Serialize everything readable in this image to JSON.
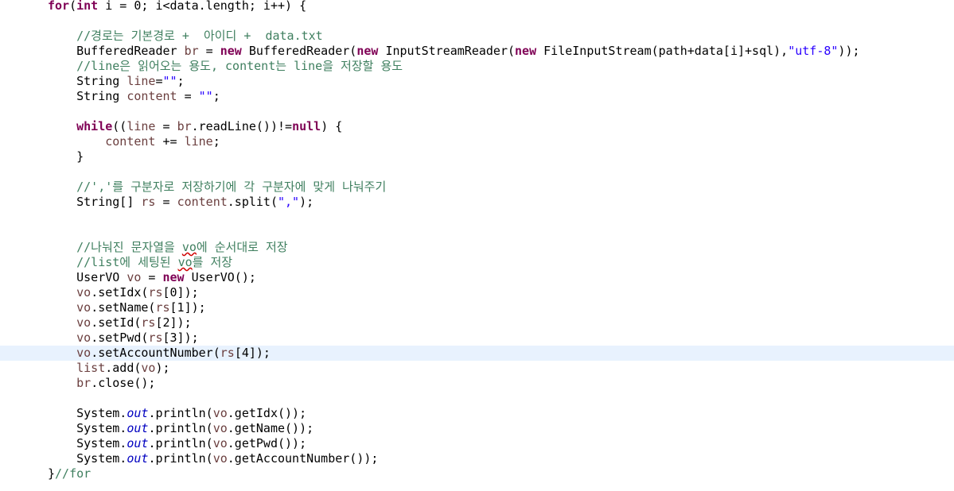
{
  "editor": {
    "current_line": 23,
    "colors": {
      "background": "#ffffff",
      "current_line": "#e8f2fe",
      "keyword": "#7f0055",
      "comment": "#3f7f5f",
      "string": "#2a00ff",
      "static_field": "#0000c0",
      "local_variable": "#6a3e3e",
      "plain": "#000000"
    },
    "lines": [
      [
        {
          "t": "for",
          "c": "kw"
        },
        {
          "t": "(",
          "c": ""
        },
        {
          "t": "int",
          "c": "kw"
        },
        {
          "t": " i = 0; i<data.length; i++) {",
          "c": ""
        }
      ],
      [],
      [
        {
          "t": "    //경로는 기본경로 +  아이디 +  data.txt",
          "c": "cm"
        }
      ],
      [
        {
          "t": "    BufferedReader ",
          "c": ""
        },
        {
          "t": "br",
          "c": "var"
        },
        {
          "t": " = ",
          "c": ""
        },
        {
          "t": "new",
          "c": "kw"
        },
        {
          "t": " BufferedReader(",
          "c": ""
        },
        {
          "t": "new",
          "c": "kw"
        },
        {
          "t": " InputStreamReader(",
          "c": ""
        },
        {
          "t": "new",
          "c": "kw"
        },
        {
          "t": " FileInputStream(path+data[i]+sql),",
          "c": ""
        },
        {
          "t": "\"utf-8\"",
          "c": "str"
        },
        {
          "t": "));",
          "c": ""
        }
      ],
      [
        {
          "t": "    //line은 읽어오는 용도, content는 line을 저장할 용도",
          "c": "cm"
        }
      ],
      [
        {
          "t": "    String ",
          "c": ""
        },
        {
          "t": "line",
          "c": "var"
        },
        {
          "t": "=",
          "c": ""
        },
        {
          "t": "\"\"",
          "c": "str"
        },
        {
          "t": ";",
          "c": ""
        }
      ],
      [
        {
          "t": "    String ",
          "c": ""
        },
        {
          "t": "content",
          "c": "var"
        },
        {
          "t": " = ",
          "c": ""
        },
        {
          "t": "\"\"",
          "c": "str"
        },
        {
          "t": ";",
          "c": ""
        }
      ],
      [],
      [
        {
          "t": "    ",
          "c": ""
        },
        {
          "t": "while",
          "c": "kw"
        },
        {
          "t": "((",
          "c": ""
        },
        {
          "t": "line",
          "c": "var"
        },
        {
          "t": " = ",
          "c": ""
        },
        {
          "t": "br",
          "c": "var"
        },
        {
          "t": ".readLine())!=",
          "c": ""
        },
        {
          "t": "null",
          "c": "kw"
        },
        {
          "t": ") {",
          "c": ""
        }
      ],
      [
        {
          "t": "        ",
          "c": ""
        },
        {
          "t": "content",
          "c": "var"
        },
        {
          "t": " += ",
          "c": ""
        },
        {
          "t": "line",
          "c": "var"
        },
        {
          "t": ";",
          "c": ""
        }
      ],
      [
        {
          "t": "    }",
          "c": ""
        }
      ],
      [],
      [
        {
          "t": "    //','를 구분자로 저장하기에 각 구분자에 맞게 나눠주기",
          "c": "cm"
        }
      ],
      [
        {
          "t": "    String[] ",
          "c": ""
        },
        {
          "t": "rs",
          "c": "var"
        },
        {
          "t": " = ",
          "c": ""
        },
        {
          "t": "content",
          "c": "var"
        },
        {
          "t": ".split(",
          "c": ""
        },
        {
          "t": "\",\"",
          "c": "str"
        },
        {
          "t": ");",
          "c": ""
        }
      ],
      [],
      [],
      [
        {
          "t": "    //나눠진 문자열을 ",
          "c": "cm"
        },
        {
          "t": "vo",
          "c": "cm spell"
        },
        {
          "t": "에 순서대로 저장",
          "c": "cm"
        }
      ],
      [
        {
          "t": "    //list에 세팅된 ",
          "c": "cm"
        },
        {
          "t": "vo",
          "c": "cm spell"
        },
        {
          "t": "를 저장",
          "c": "cm"
        }
      ],
      [
        {
          "t": "    UserVO ",
          "c": ""
        },
        {
          "t": "vo",
          "c": "var"
        },
        {
          "t": " = ",
          "c": ""
        },
        {
          "t": "new",
          "c": "kw"
        },
        {
          "t": " UserVO();",
          "c": ""
        }
      ],
      [
        {
          "t": "    ",
          "c": ""
        },
        {
          "t": "vo",
          "c": "var"
        },
        {
          "t": ".setIdx(",
          "c": ""
        },
        {
          "t": "rs",
          "c": "var"
        },
        {
          "t": "[0]);",
          "c": ""
        }
      ],
      [
        {
          "t": "    ",
          "c": ""
        },
        {
          "t": "vo",
          "c": "var"
        },
        {
          "t": ".setName(",
          "c": ""
        },
        {
          "t": "rs",
          "c": "var"
        },
        {
          "t": "[1]);",
          "c": ""
        }
      ],
      [
        {
          "t": "    ",
          "c": ""
        },
        {
          "t": "vo",
          "c": "var"
        },
        {
          "t": ".setId(",
          "c": ""
        },
        {
          "t": "rs",
          "c": "var"
        },
        {
          "t": "[2]);",
          "c": ""
        }
      ],
      [
        {
          "t": "    ",
          "c": ""
        },
        {
          "t": "vo",
          "c": "var"
        },
        {
          "t": ".setPwd(",
          "c": ""
        },
        {
          "t": "rs",
          "c": "var"
        },
        {
          "t": "[3]);",
          "c": ""
        }
      ],
      [
        {
          "t": "    ",
          "c": ""
        },
        {
          "t": "vo",
          "c": "var"
        },
        {
          "t": ".setAccountNumber(",
          "c": ""
        },
        {
          "t": "rs",
          "c": "var"
        },
        {
          "t": "[4]);",
          "c": ""
        }
      ],
      [
        {
          "t": "    ",
          "c": ""
        },
        {
          "t": "list",
          "c": "var"
        },
        {
          "t": ".add(",
          "c": ""
        },
        {
          "t": "vo",
          "c": "var"
        },
        {
          "t": ");",
          "c": ""
        }
      ],
      [
        {
          "t": "    ",
          "c": ""
        },
        {
          "t": "br",
          "c": "var"
        },
        {
          "t": ".close();",
          "c": ""
        }
      ],
      [],
      [
        {
          "t": "    System.",
          "c": ""
        },
        {
          "t": "out",
          "c": "static"
        },
        {
          "t": ".println(",
          "c": ""
        },
        {
          "t": "vo",
          "c": "var"
        },
        {
          "t": ".getIdx());",
          "c": ""
        }
      ],
      [
        {
          "t": "    System.",
          "c": ""
        },
        {
          "t": "out",
          "c": "static"
        },
        {
          "t": ".println(",
          "c": ""
        },
        {
          "t": "vo",
          "c": "var"
        },
        {
          "t": ".getName());",
          "c": ""
        }
      ],
      [
        {
          "t": "    System.",
          "c": ""
        },
        {
          "t": "out",
          "c": "static"
        },
        {
          "t": ".println(",
          "c": ""
        },
        {
          "t": "vo",
          "c": "var"
        },
        {
          "t": ".getPwd());",
          "c": ""
        }
      ],
      [
        {
          "t": "    System.",
          "c": ""
        },
        {
          "t": "out",
          "c": "static"
        },
        {
          "t": ".println(",
          "c": ""
        },
        {
          "t": "vo",
          "c": "var"
        },
        {
          "t": ".getAccountNumber());",
          "c": ""
        }
      ],
      [
        {
          "t": "}",
          "c": ""
        },
        {
          "t": "//for",
          "c": "cm"
        }
      ]
    ]
  }
}
